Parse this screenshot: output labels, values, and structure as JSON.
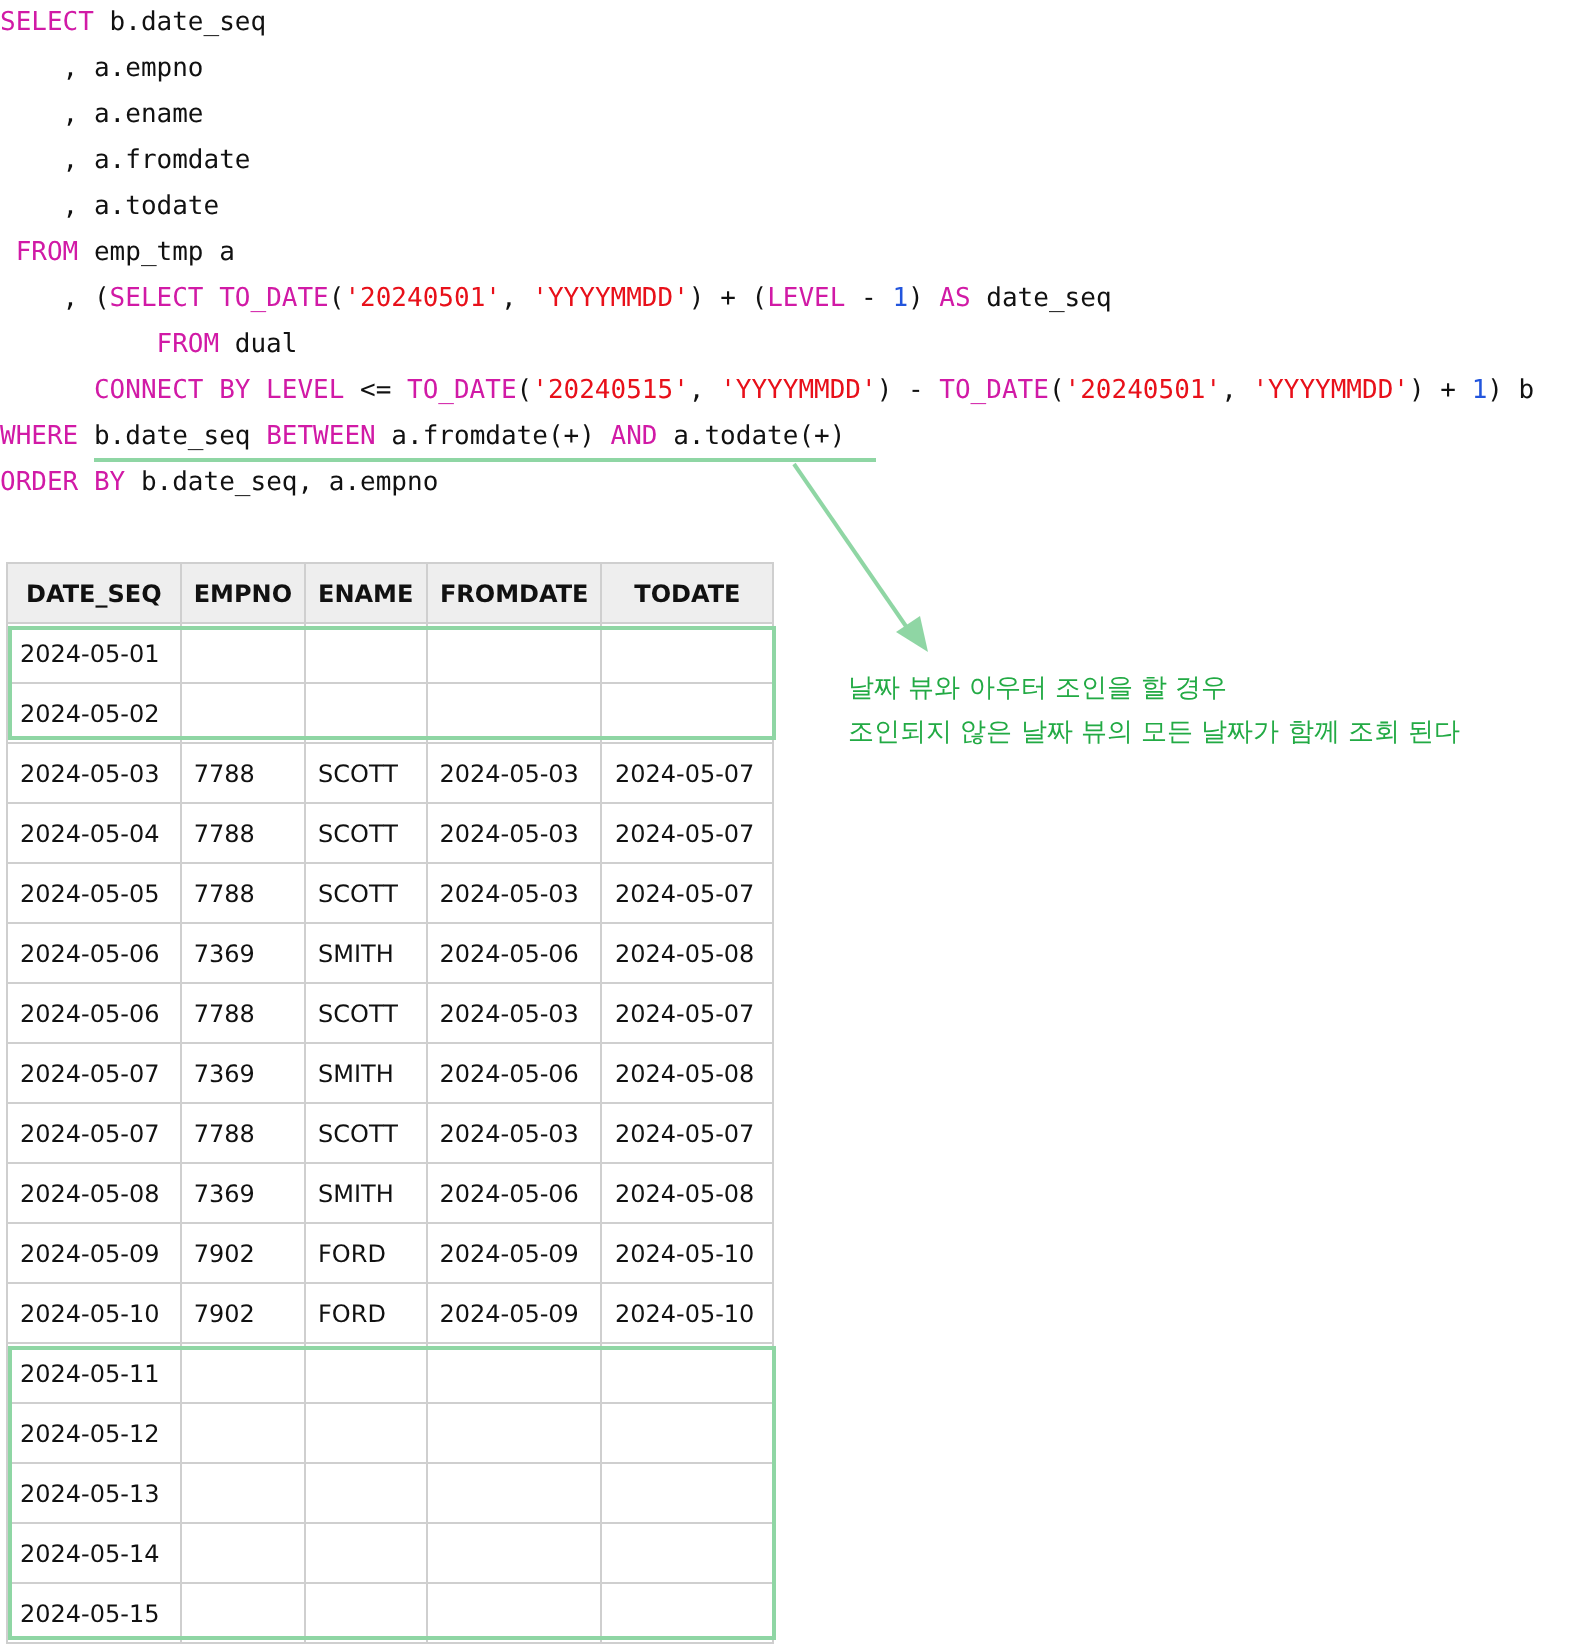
{
  "code": {
    "lines": [
      [
        {
          "kind": "keyword",
          "text": "SELECT"
        },
        {
          "kind": "plain",
          "text": " b.date_seq"
        }
      ],
      [
        {
          "kind": "plain",
          "text": "    , a.empno"
        }
      ],
      [
        {
          "kind": "plain",
          "text": "    , a.ename"
        }
      ],
      [
        {
          "kind": "plain",
          "text": "    , a.fromdate"
        }
      ],
      [
        {
          "kind": "plain",
          "text": "    , a.todate"
        }
      ],
      [
        {
          "kind": "keyword",
          "text": " FROM"
        },
        {
          "kind": "plain",
          "text": " emp_tmp a"
        }
      ],
      [
        {
          "kind": "plain",
          "text": "    , ("
        },
        {
          "kind": "keyword",
          "text": "SELECT TO_DATE"
        },
        {
          "kind": "plain",
          "text": "("
        },
        {
          "kind": "string",
          "text": "'20240501'"
        },
        {
          "kind": "plain",
          "text": ", "
        },
        {
          "kind": "string",
          "text": "'YYYYMMDD'"
        },
        {
          "kind": "plain",
          "text": ") + ("
        },
        {
          "kind": "keyword",
          "text": "LEVEL"
        },
        {
          "kind": "plain",
          "text": " - "
        },
        {
          "kind": "number",
          "text": "1"
        },
        {
          "kind": "plain",
          "text": ") "
        },
        {
          "kind": "keyword",
          "text": "AS"
        },
        {
          "kind": "plain",
          "text": " date_seq"
        }
      ],
      [
        {
          "kind": "keyword",
          "text": "          FROM"
        },
        {
          "kind": "plain",
          "text": " dual"
        }
      ],
      [
        {
          "kind": "keyword",
          "text": "      CONNECT BY LEVEL"
        },
        {
          "kind": "plain",
          "text": " <= "
        },
        {
          "kind": "keyword",
          "text": "TO_DATE"
        },
        {
          "kind": "plain",
          "text": "("
        },
        {
          "kind": "string",
          "text": "'20240515'"
        },
        {
          "kind": "plain",
          "text": ", "
        },
        {
          "kind": "string",
          "text": "'YYYYMMDD'"
        },
        {
          "kind": "plain",
          "text": ") - "
        },
        {
          "kind": "keyword",
          "text": "TO_DATE"
        },
        {
          "kind": "plain",
          "text": "("
        },
        {
          "kind": "string",
          "text": "'20240501'"
        },
        {
          "kind": "plain",
          "text": ", "
        },
        {
          "kind": "string",
          "text": "'YYYYMMDD'"
        },
        {
          "kind": "plain",
          "text": ") + "
        },
        {
          "kind": "number",
          "text": "1"
        },
        {
          "kind": "plain",
          "text": ") b"
        }
      ],
      [
        {
          "kind": "keyword",
          "text": "WHERE"
        },
        {
          "kind": "plain",
          "text": " b.date_seq "
        },
        {
          "kind": "keyword",
          "text": "BETWEEN"
        },
        {
          "kind": "plain",
          "text": " a.fromdate(+) "
        },
        {
          "kind": "keyword",
          "text": "AND"
        },
        {
          "kind": "plain",
          "text": " a.todate(+)"
        }
      ],
      [
        {
          "kind": "keyword",
          "text": "ORDER BY"
        },
        {
          "kind": "plain",
          "text": " b.date_seq, a.empno"
        }
      ]
    ]
  },
  "table": {
    "columns": [
      "DATE_SEQ",
      "EMPNO",
      "ENAME",
      "FROMDATE",
      "TODATE"
    ],
    "rows": [
      {
        "cells": [
          "2024-05-01"
        ],
        "highlighted": true
      },
      {
        "cells": [
          "2024-05-02"
        ],
        "highlighted": true
      },
      {
        "cells": [
          "2024-05-03",
          "7788",
          "SCOTT",
          "2024-05-03",
          "2024-05-07"
        ],
        "highlighted": false
      },
      {
        "cells": [
          "2024-05-04",
          "7788",
          "SCOTT",
          "2024-05-03",
          "2024-05-07"
        ],
        "highlighted": false
      },
      {
        "cells": [
          "2024-05-05",
          "7788",
          "SCOTT",
          "2024-05-03",
          "2024-05-07"
        ],
        "highlighted": false
      },
      {
        "cells": [
          "2024-05-06",
          "7369",
          "SMITH",
          "2024-05-06",
          "2024-05-08"
        ],
        "highlighted": false
      },
      {
        "cells": [
          "2024-05-06",
          "7788",
          "SCOTT",
          "2024-05-03",
          "2024-05-07"
        ],
        "highlighted": false
      },
      {
        "cells": [
          "2024-05-07",
          "7369",
          "SMITH",
          "2024-05-06",
          "2024-05-08"
        ],
        "highlighted": false
      },
      {
        "cells": [
          "2024-05-07",
          "7788",
          "SCOTT",
          "2024-05-03",
          "2024-05-07"
        ],
        "highlighted": false
      },
      {
        "cells": [
          "2024-05-08",
          "7369",
          "SMITH",
          "2024-05-06",
          "2024-05-08"
        ],
        "highlighted": false
      },
      {
        "cells": [
          "2024-05-09",
          "7902",
          "FORD",
          "2024-05-09",
          "2024-05-10"
        ],
        "highlighted": false
      },
      {
        "cells": [
          "2024-05-10",
          "7902",
          "FORD",
          "2024-05-09",
          "2024-05-10"
        ],
        "highlighted": false
      },
      {
        "cells": [
          "2024-05-11"
        ],
        "highlighted": true
      },
      {
        "cells": [
          "2024-05-12"
        ],
        "highlighted": true
      },
      {
        "cells": [
          "2024-05-13"
        ],
        "highlighted": true
      },
      {
        "cells": [
          "2024-05-14"
        ],
        "highlighted": true
      },
      {
        "cells": [
          "2024-05-15"
        ],
        "highlighted": true
      }
    ]
  },
  "annotation": {
    "lines": [
      "날짜 뷰와 아우터 조인을 할 경우",
      "조인되지 않은 날짜 뷰의 모든 날짜가 함께 조회 된다"
    ]
  }
}
